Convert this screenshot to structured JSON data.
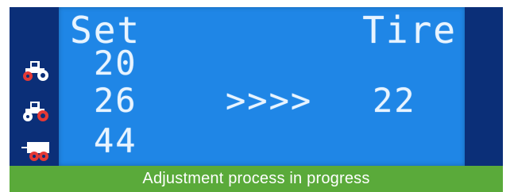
{
  "display": {
    "set_title": "Set",
    "tire_title": "Tire",
    "set_values": [
      "20",
      "26",
      "44"
    ],
    "arrows": ">>>>",
    "tire_value": "22"
  },
  "icons": [
    {
      "name": "tractor-front-axle-icon",
      "highlight_color": "#e53935"
    },
    {
      "name": "tractor-rear-axle-icon",
      "highlight_color": "#e53935"
    },
    {
      "name": "trailer-axle-icon",
      "highlight_color": "#e53935"
    }
  ],
  "status": {
    "message": "Adjustment process in progress"
  },
  "colors": {
    "panel_dark": "#0b2f78",
    "lcd_blue": "#1f86e6",
    "lcd_text": "#e8f4ff",
    "status_green": "#5aaa3a",
    "accent_red": "#e53935"
  }
}
